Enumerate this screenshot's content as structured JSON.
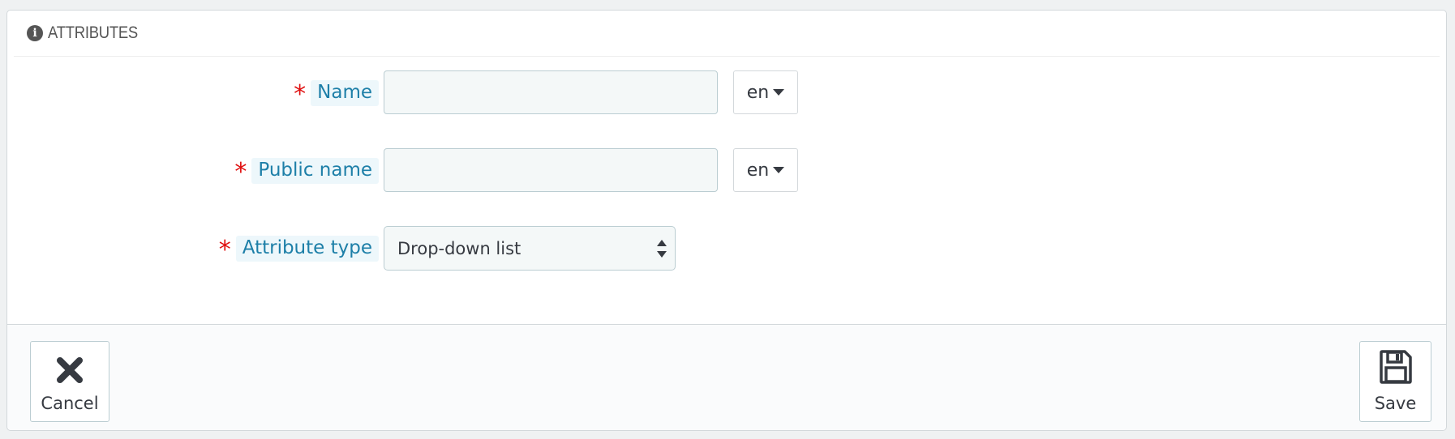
{
  "panel": {
    "title": "ATTRIBUTES",
    "icon": "info-circle-icon"
  },
  "form": {
    "required_marker": "*",
    "fields": [
      {
        "label": "Name",
        "value": "",
        "lang": "en"
      },
      {
        "label": "Public name",
        "value": "",
        "lang": "en"
      }
    ],
    "attribute_type": {
      "label": "Attribute type",
      "selected": "Drop-down list"
    }
  },
  "footer": {
    "cancel_label": "Cancel",
    "cancel_icon": "close-icon",
    "save_label": "Save",
    "save_icon": "floppy-disk-icon"
  },
  "colors": {
    "label_text": "#1d7fa8",
    "label_bg": "#edf7fb",
    "required": "#e01010",
    "input_bg": "#f4f8f8",
    "input_border": "#bbcdd2"
  }
}
